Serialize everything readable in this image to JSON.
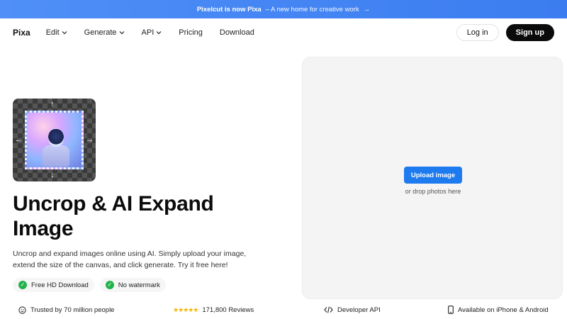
{
  "banner": {
    "product": "Pixelcut is now Pixa",
    "tagline": "– A new home for creative work",
    "arrow": "→"
  },
  "nav": {
    "logo": "Pixa",
    "items": [
      {
        "label": "Edit",
        "dropdown": true
      },
      {
        "label": "Generate",
        "dropdown": true
      },
      {
        "label": "API",
        "dropdown": true
      },
      {
        "label": "Pricing",
        "dropdown": false
      },
      {
        "label": "Download",
        "dropdown": false
      }
    ],
    "login": "Log in",
    "signup": "Sign up"
  },
  "hero": {
    "title": "Uncrop & AI Expand Image",
    "description": "Uncrop and expand images online using AI. Simply upload your image, extend the size of the canvas, and click generate. Try it free here!",
    "features": [
      {
        "label": "Free HD Download",
        "icon": "check-icon"
      },
      {
        "label": "No watermark",
        "icon": "check-icon"
      }
    ],
    "thumbnail_arrows": {
      "up": "↑",
      "down": "↓",
      "left": "←",
      "right": "→"
    }
  },
  "upload": {
    "button": "Upload image",
    "drop_text": "or drop photos here"
  },
  "footer": {
    "trusted": "Trusted by 70 million people",
    "stars": "★★★★★",
    "reviews": "171,800 Reviews",
    "api": "Developer API",
    "apps": "Available on iPhone & Android"
  },
  "colors": {
    "banner": "#3b7cf0",
    "primary_button": "#1e7bef",
    "signup": "#0b0b0b",
    "check": "#22b34b",
    "stars": "#f4b400"
  }
}
